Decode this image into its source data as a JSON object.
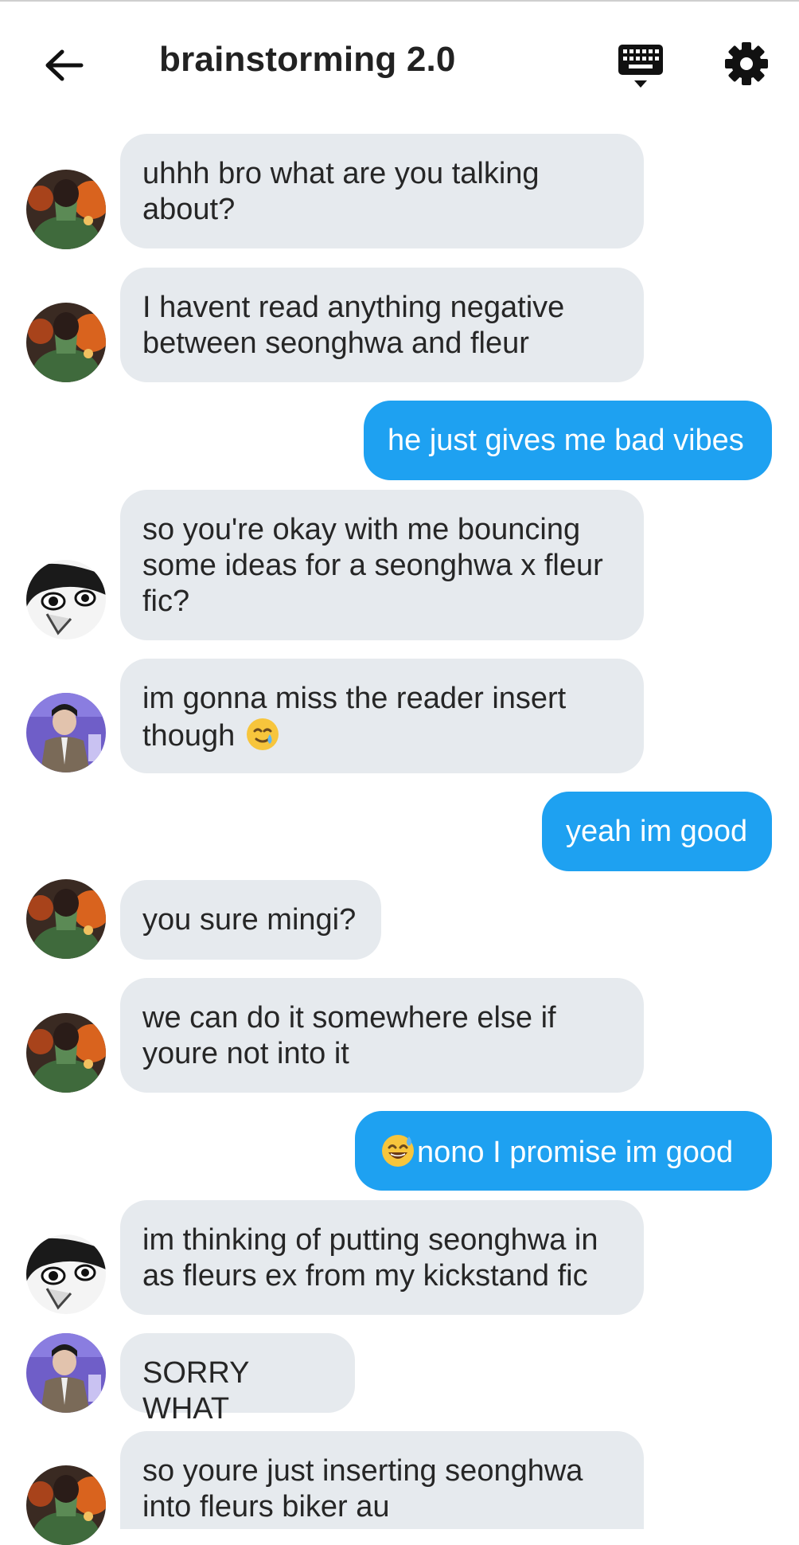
{
  "header": {
    "title": "brainstorming 2.0",
    "back_icon": "arrow-left-icon",
    "keyboard_icon": "keyboard-icon",
    "settings_icon": "gear-icon"
  },
  "colors": {
    "incoming_bubble": "#e6eaee",
    "outgoing_bubble": "#1ea1f1",
    "text": "#262626"
  },
  "messages": [
    {
      "side": "in",
      "avatar": "green-avatar",
      "lines": [
        "uhhh bro what are you talking",
        "about?"
      ]
    },
    {
      "side": "in",
      "avatar": "green-avatar",
      "lines": [
        "I havent read anything negative",
        "between seonghwa and fleur"
      ]
    },
    {
      "side": "out",
      "lines": [
        "he just gives me bad vibes"
      ]
    },
    {
      "side": "in",
      "avatar": "manga-avatar",
      "lines": [
        "so you're okay with me bouncing",
        "some ideas for a seonghwa x fleur",
        "fic?"
      ]
    },
    {
      "side": "in",
      "avatar": "purple-avatar",
      "lines": [
        "im gonna miss the reader insert",
        "though"
      ],
      "emoji": "smiling-face-with-tear-emoji"
    },
    {
      "side": "out",
      "lines": [
        "yeah im good"
      ]
    },
    {
      "side": "in",
      "avatar": "green-avatar",
      "lines": [
        "you sure mingi?"
      ]
    },
    {
      "side": "in",
      "avatar": "green-avatar",
      "lines": [
        "we can do it somewhere else if",
        "youre not into it"
      ]
    },
    {
      "side": "out",
      "lines": [
        "nono I promise im good"
      ],
      "emoji": "grinning-sweat-emoji"
    },
    {
      "side": "in",
      "avatar": "manga-avatar",
      "lines": [
        "im thinking of putting seonghwa in",
        "as fleurs ex from my kickstand fic"
      ]
    },
    {
      "side": "in",
      "avatar": "purple-avatar",
      "lines": [
        "SORRY WHAT"
      ]
    },
    {
      "side": "in",
      "avatar": "green-avatar",
      "lines": [
        "so youre just inserting seonghwa",
        "into fleurs biker au"
      ]
    }
  ]
}
